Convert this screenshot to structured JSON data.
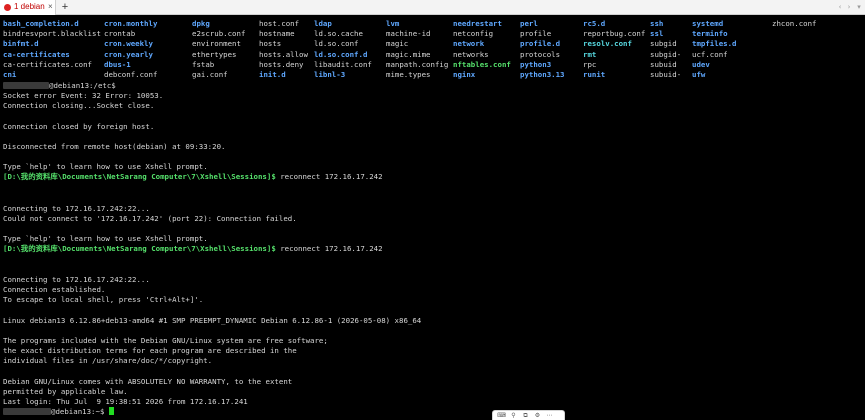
{
  "tab": {
    "label": "1 debian",
    "close": "×",
    "add": "+"
  },
  "tabbar_nav": {
    "prev": "‹",
    "next": "›",
    "menu": "▾"
  },
  "listing": [
    [
      {
        "name": "bash_completion.d",
        "kind": "dir"
      },
      {
        "name": "cron.monthly",
        "kind": "dir"
      },
      {
        "name": "dpkg",
        "kind": "dir"
      },
      {
        "name": "host.conf",
        "kind": "plain"
      },
      {
        "name": "ldap",
        "kind": "dir"
      },
      {
        "name": "lvm",
        "kind": "dir"
      },
      {
        "name": "needrestart",
        "kind": "dir"
      },
      {
        "name": "perl",
        "kind": "dir"
      },
      {
        "name": "rc5.d",
        "kind": "dir"
      },
      {
        "name": "ssh",
        "kind": "dir"
      },
      {
        "name": "systemd",
        "kind": "dir"
      },
      {
        "name": "zhcon.conf",
        "kind": "plain"
      }
    ],
    [
      {
        "name": "bindresvport.blacklist",
        "kind": "plain"
      },
      {
        "name": "crontab",
        "kind": "plain"
      },
      {
        "name": "e2scrub.conf",
        "kind": "plain"
      },
      {
        "name": "hostname",
        "kind": "plain"
      },
      {
        "name": "ld.so.cache",
        "kind": "plain"
      },
      {
        "name": "machine-id",
        "kind": "plain"
      },
      {
        "name": "netconfig",
        "kind": "plain"
      },
      {
        "name": "profile",
        "kind": "plain"
      },
      {
        "name": "reportbug.conf",
        "kind": "plain"
      },
      {
        "name": "ssl",
        "kind": "dir"
      },
      {
        "name": "terminfo",
        "kind": "dir"
      }
    ],
    [
      {
        "name": "binfmt.d",
        "kind": "dir"
      },
      {
        "name": "cron.weekly",
        "kind": "dir"
      },
      {
        "name": "environment",
        "kind": "plain"
      },
      {
        "name": "hosts",
        "kind": "plain"
      },
      {
        "name": "ld.so.conf",
        "kind": "plain"
      },
      {
        "name": "magic",
        "kind": "plain"
      },
      {
        "name": "network",
        "kind": "dir"
      },
      {
        "name": "profile.d",
        "kind": "dir"
      },
      {
        "name": "resolv.conf",
        "kind": "link"
      },
      {
        "name": "subgid",
        "kind": "plain"
      },
      {
        "name": "tmpfiles.d",
        "kind": "dir"
      }
    ],
    [
      {
        "name": "ca-certificates",
        "kind": "dir"
      },
      {
        "name": "cron.yearly",
        "kind": "dir"
      },
      {
        "name": "ethertypes",
        "kind": "plain"
      },
      {
        "name": "hosts.allow",
        "kind": "plain"
      },
      {
        "name": "ld.so.conf.d",
        "kind": "dir"
      },
      {
        "name": "magic.mime",
        "kind": "plain"
      },
      {
        "name": "networks",
        "kind": "plain"
      },
      {
        "name": "protocols",
        "kind": "plain"
      },
      {
        "name": "rmt",
        "kind": "link"
      },
      {
        "name": "subgid-",
        "kind": "plain"
      },
      {
        "name": "ucf.conf",
        "kind": "plain"
      }
    ],
    [
      {
        "name": "ca-certificates.conf",
        "kind": "plain"
      },
      {
        "name": "dbus-1",
        "kind": "dir"
      },
      {
        "name": "fstab",
        "kind": "plain"
      },
      {
        "name": "hosts.deny",
        "kind": "plain"
      },
      {
        "name": "libaudit.conf",
        "kind": "plain"
      },
      {
        "name": "manpath.config",
        "kind": "plain"
      },
      {
        "name": "nftables.conf",
        "kind": "exe"
      },
      {
        "name": "python3",
        "kind": "dir"
      },
      {
        "name": "rpc",
        "kind": "plain"
      },
      {
        "name": "subuid",
        "kind": "plain"
      },
      {
        "name": "udev",
        "kind": "dir"
      }
    ],
    [
      {
        "name": "cni",
        "kind": "dir"
      },
      {
        "name": "debconf.conf",
        "kind": "plain"
      },
      {
        "name": "gai.conf",
        "kind": "plain"
      },
      {
        "name": "init.d",
        "kind": "dir"
      },
      {
        "name": "libnl-3",
        "kind": "dir"
      },
      {
        "name": "mime.types",
        "kind": "plain"
      },
      {
        "name": "nginx",
        "kind": "dir"
      },
      {
        "name": "python3.13",
        "kind": "dir"
      },
      {
        "name": "runit",
        "kind": "dir"
      },
      {
        "name": "subuid-",
        "kind": "plain"
      },
      {
        "name": "ufw",
        "kind": "dir"
      }
    ]
  ],
  "session": {
    "prompt_etc": "@debian13:/etc$",
    "socket_error": "Socket error Event: 32 Error: 10053.",
    "conn_closing": "Connection closing...Socket close.",
    "closed_by_foreign": "Connection closed by foreign host.",
    "disconnected": "Disconnected from remote host(debian) at 09:33:20.",
    "help_hint": "Type `help' to learn how to use Xshell prompt.",
    "local_prompt": "[D:\\我的资料库\\Documents\\NetSarang Computer\\7\\Xshell\\Sessions]$",
    "reconnect_cmd": " reconnect 172.16.17.242",
    "connecting": "Connecting to 172.16.17.242:22...",
    "could_not_connect": "Could not connect to '172.16.17.242' (port 22): Connection failed.",
    "established": "Connection established.",
    "escape_hint": "To escape to local shell, press 'Ctrl+Alt+]'.",
    "uname": "Linux debian13 6.12.86+deb13-amd64 #1 SMP PREEMPT_DYNAMIC Debian 6.12.86-1 (2026-05-08) x86_64",
    "motd_1": "The programs included with the Debian GNU/Linux system are free software;",
    "motd_2": "the exact distribution terms for each program are described in the",
    "motd_3": "individual files in /usr/share/doc/*/copyright.",
    "motd_4": "Debian GNU/Linux comes with ABSOLUTELY NO WARRANTY, to the extent",
    "motd_5": "permitted by applicable law.",
    "last_login": "Last login: Thu Jul  9 19:38:51 2026 from 172.16.17.241",
    "prompt_home": "@debian13:~$"
  },
  "colors": {
    "directory": "#5fa8ff",
    "executable": "#55e06b",
    "symlink": "#57d8e0",
    "text": "#d8d8d8",
    "cursor": "#22dd22"
  }
}
